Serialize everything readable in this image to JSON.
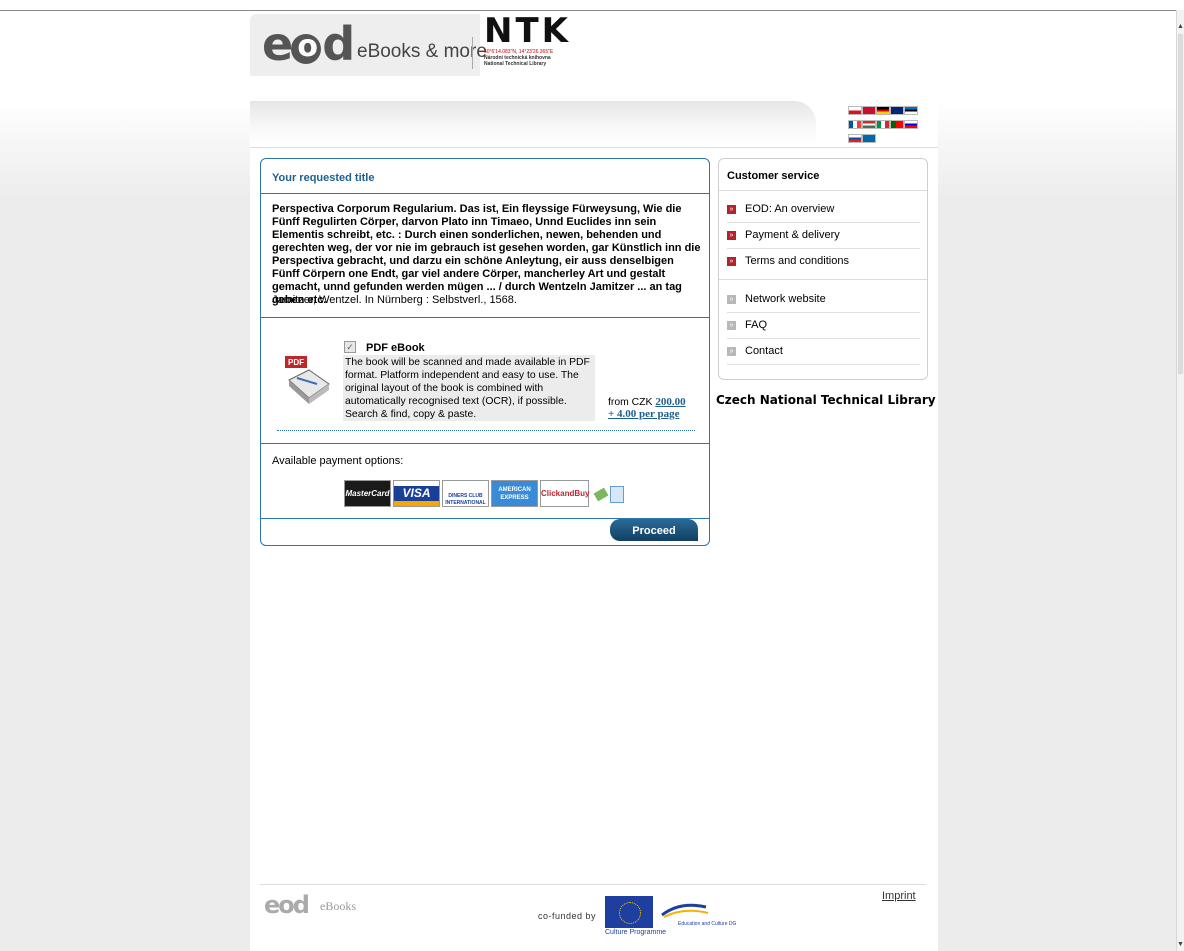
{
  "header": {
    "logo_text": "eod",
    "tagline": "eBooks & more",
    "ntk_logo": "NTK",
    "ntk_coordinates": "50°6'14.083\"N, 14°23'26.365\"E",
    "ntk_name_cz": "Národní technická knihovna",
    "ntk_name_en": "National Technical Library"
  },
  "languages": [
    "cs",
    "da",
    "de",
    "en",
    "et",
    "fr",
    "hu",
    "it",
    "pt",
    "sl",
    "sk",
    "sv"
  ],
  "request": {
    "section_title": "Your requested title",
    "book_title": "Perspectiva Corporum Regularium. Das ist, Ein fleyssige Fürweysung, Wie die Fünff Regulirten Cörper, darvon Plato inn Timaeo, Unnd Euclides inn sein Elementis schreibt, etc. : Durch einen sonderlichen, newen, behenden und gerechten weg, der vor nie im gebrauch ist gesehen worden, gar Künstlich inn die Perspectiva gebracht, und darzu ein schöne Anleytung, eir auss denselbigen Fünff Cörpern one Endt, gar viel andere Cörper, mancherley Art und gestalt gemacht, unnd gefunden werden mügen ... / durch Wentzeln Jamitzer ... an tag geben etc.",
    "book_author": "Jamitzer, Wentzel. In Nürnberg : Selbstverl., 1568.",
    "product": {
      "label": "PDF eBook",
      "checked": true,
      "icon_label": "PDF",
      "description": "The book will be scanned and made available in PDF format. Platform independent and easy to use. The original layout of the book is combined with automatically recognised text (OCR), if possible. Search & find, copy & paste.",
      "price_prefix": "from CZK",
      "price": "200.00",
      "price_per_page": "+ 4.00 per page"
    },
    "payment_label": "Available payment options:",
    "payment_options": [
      "MasterCard",
      "VISA",
      "DINERS CLUB INTERNATIONAL",
      "AMERICAN EXPRESS",
      "ClickandBuy"
    ],
    "proceed_label": "Proceed"
  },
  "customer_service": {
    "title": "Customer service",
    "items_primary": [
      "EOD: An overview",
      "Payment & delivery",
      "Terms and conditions"
    ],
    "items_secondary": [
      "Network website",
      "FAQ",
      "Contact"
    ]
  },
  "library_name": "Czech National Technical Library",
  "footer": {
    "logo_text": "eod",
    "ebooks_text": "eBooks",
    "cofunded_text": "co-funded by",
    "culture_text": "Culture Programme",
    "edu_text": "Education and Culture DG",
    "imprint_label": "Imprint"
  }
}
